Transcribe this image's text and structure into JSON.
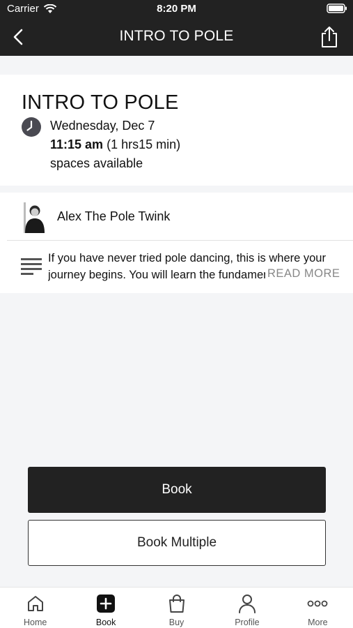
{
  "status_bar": {
    "carrier": "Carrier",
    "time": "8:20 PM"
  },
  "nav": {
    "title": "INTRO TO POLE"
  },
  "class_info": {
    "title": "INTRO TO POLE",
    "date": "Wednesday, Dec 7",
    "start_time": "11:15 am",
    "duration": "(1 hrs15 min)",
    "spaces": "spaces available"
  },
  "instructor": {
    "name": "Alex The Pole Twink"
  },
  "description": {
    "line1": "If you have never tried pole dancing, this is where your",
    "line2": "journey begins. You will learn the fundamentals of po...",
    "read_more": "READ MORE"
  },
  "actions": {
    "book": "Book",
    "book_multiple": "Book Multiple"
  },
  "tabs": [
    {
      "label": "Home",
      "icon": "home-icon"
    },
    {
      "label": "Book",
      "icon": "plus-square-icon"
    },
    {
      "label": "Buy",
      "icon": "shopping-bag-icon"
    },
    {
      "label": "Profile",
      "icon": "profile-icon"
    },
    {
      "label": "More",
      "icon": "more-dots-icon"
    }
  ],
  "active_tab": "Book",
  "colors": {
    "header_bg": "#222222",
    "accent": "#222222",
    "page_bg": "#f4f5f7"
  }
}
